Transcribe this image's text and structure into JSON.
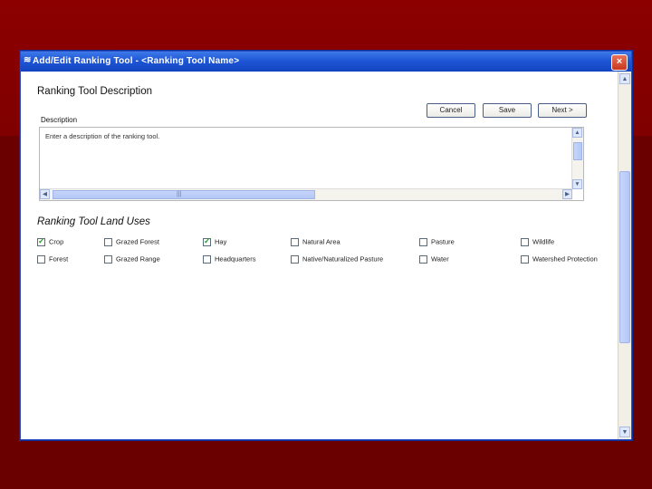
{
  "window": {
    "title": "Add/Edit Ranking Tool - <Ranking Tool Name>",
    "close_label": "×"
  },
  "description_section": {
    "heading": "Ranking Tool Description",
    "field_label": "Description",
    "placeholder": "Enter a description of the ranking tool.",
    "buttons": {
      "cancel": "Cancel",
      "save": "Save",
      "next": "Next >"
    }
  },
  "land_uses": {
    "heading": "Ranking Tool Land Uses",
    "items": [
      {
        "label": "Crop",
        "checked": true
      },
      {
        "label": "Grazed Forest",
        "checked": false
      },
      {
        "label": "Hay",
        "checked": true
      },
      {
        "label": "Natural Area",
        "checked": false
      },
      {
        "label": "Pasture",
        "checked": false
      },
      {
        "label": "Wildlife",
        "checked": false
      },
      {
        "label": "Forest",
        "checked": false
      },
      {
        "label": "Grazed Range",
        "checked": false
      },
      {
        "label": "Headquarters",
        "checked": false
      },
      {
        "label": "Native/Naturalized Pasture",
        "checked": false
      },
      {
        "label": "Water",
        "checked": false
      },
      {
        "label": "Watershed Protection",
        "checked": false
      }
    ]
  },
  "icons": {
    "app": "app-icon",
    "close": "close-icon",
    "check": "checkmark-icon"
  },
  "colors": {
    "titlebar": "#1f56d6",
    "slide_background": "#7a0000",
    "check": "#2aa02a"
  }
}
